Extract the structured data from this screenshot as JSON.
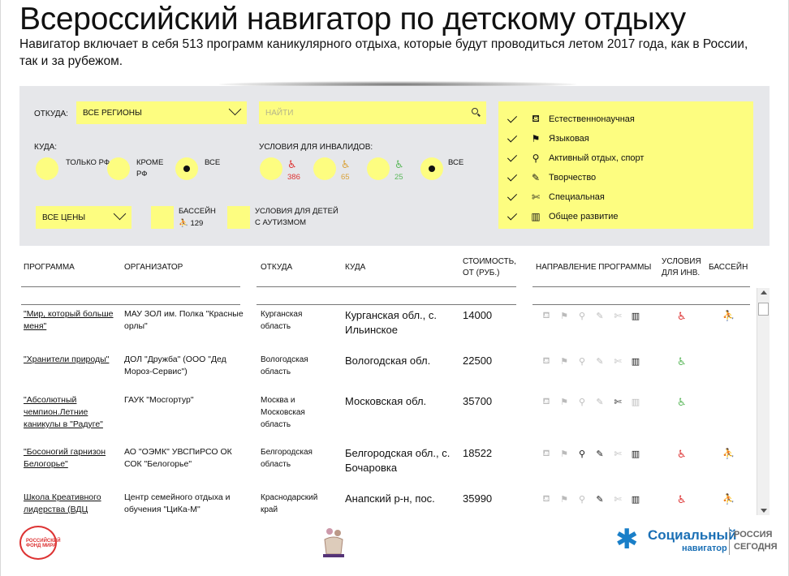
{
  "header": {
    "title": "Всероссийский навигатор по детскому отдыху",
    "lead": "Навигатор включает в себя 513 программ каникулярного отдыха, которые будут проводиться летом 2017 года, как в России, так и за рубежом."
  },
  "filters": {
    "from_label": "Откуда:",
    "from_value": "Все регионы",
    "search_placeholder": "Найти",
    "to_label": "Куда:",
    "to_options": [
      "Только РФ",
      "Кроме РФ",
      "Все"
    ],
    "to_selected": "Все",
    "disabled_label": "Условия для инвалидов:",
    "disabled_options": [
      {
        "count": "386",
        "color": "#d33"
      },
      {
        "count": "65",
        "color": "#d9a23a"
      },
      {
        "count": "25",
        "color": "#5cb85c"
      },
      {
        "label": "Все"
      }
    ],
    "price_value": "Все цены",
    "pool_label": "Бассейн",
    "pool_count": "129",
    "autism_label": "Условия для детей с аутизмом",
    "directions": [
      {
        "label": "Естественнонаучная",
        "icon": "fish-icon",
        "glyph": "⛾"
      },
      {
        "label": "Языковая",
        "icon": "flag-icon",
        "glyph": "⚑"
      },
      {
        "label": "Активный отдых, спорт",
        "icon": "bicycle-icon",
        "glyph": "⚲"
      },
      {
        "label": "Творчество",
        "icon": "palette-icon",
        "glyph": "✎"
      },
      {
        "label": "Специальная",
        "icon": "wrench-icon",
        "glyph": "✄"
      },
      {
        "label": "Общее развитие",
        "icon": "book-icon",
        "glyph": "▥"
      }
    ]
  },
  "table": {
    "headers": {
      "program": "Программа",
      "organizer": "Организатор",
      "from": "Откуда",
      "to": "Куда",
      "cost": "Стоимость, от (руб.)",
      "direction": "Направление программы",
      "disabled": "Условия для инв.",
      "pool": "Бассейн"
    },
    "rows": [
      {
        "program": "\"Мир, который больше меня\"",
        "organizer": "МАУ ЗОЛ им. Полка \"Красные орлы\"",
        "from": "Курганская область",
        "to": "Курганская обл., с. Ильинское",
        "cost": "14000",
        "dirs": [
          false,
          false,
          false,
          false,
          false,
          true
        ],
        "wc_color": "#d33",
        "pool": true
      },
      {
        "program": "\"Хранители природы\"",
        "organizer": "ДОЛ \"Дружба\" (ООО \"Дед Мороз-Сервис\")",
        "from": "Вологодская область",
        "to": "Вологодская обл.",
        "cost": "22500",
        "dirs": [
          false,
          false,
          false,
          false,
          false,
          true
        ],
        "wc_color": "#5cb85c",
        "pool": false
      },
      {
        "program": "\"Абсолютный чемпион.Летние каникулы в \"Радуге\"",
        "organizer": "ГАУК \"Мосгортур\"",
        "from": "Москва и Московская область",
        "to": "Московская обл.",
        "cost": "35700",
        "dirs": [
          false,
          false,
          false,
          false,
          true,
          false
        ],
        "wc_color": "#5cb85c",
        "pool": false
      },
      {
        "program": "\"Босоногий гарнизон Белогорье\"",
        "organizer": "АО \"ОЭМК\" УВСПиРСО ОК СОК \"Белогорье\"",
        "from": "Белгородская область",
        "to": "Белгородская обл., с. Бочаровка",
        "cost": "18522",
        "dirs": [
          false,
          false,
          true,
          true,
          false,
          true
        ],
        "wc_color": "#d33",
        "pool": true
      },
      {
        "program": "Школа Креативного лидерства (ВДЦ",
        "organizer": "Центр семейного отдыха и обучения \"ЦиКа-М\"",
        "from": "Краснодарский край",
        "to": "Анапский р-н, пос.",
        "cost": "35990",
        "dirs": [
          false,
          false,
          false,
          true,
          false,
          true
        ],
        "wc_color": "#d33",
        "pool": true
      }
    ]
  },
  "footer": {
    "logo1_text": "РОССИЙСКИЙ ФОНД МИРА",
    "brand_main": "Социальный",
    "brand_sub": "навигатор",
    "brand_right": "РОССИЯ СЕГОДНЯ"
  }
}
